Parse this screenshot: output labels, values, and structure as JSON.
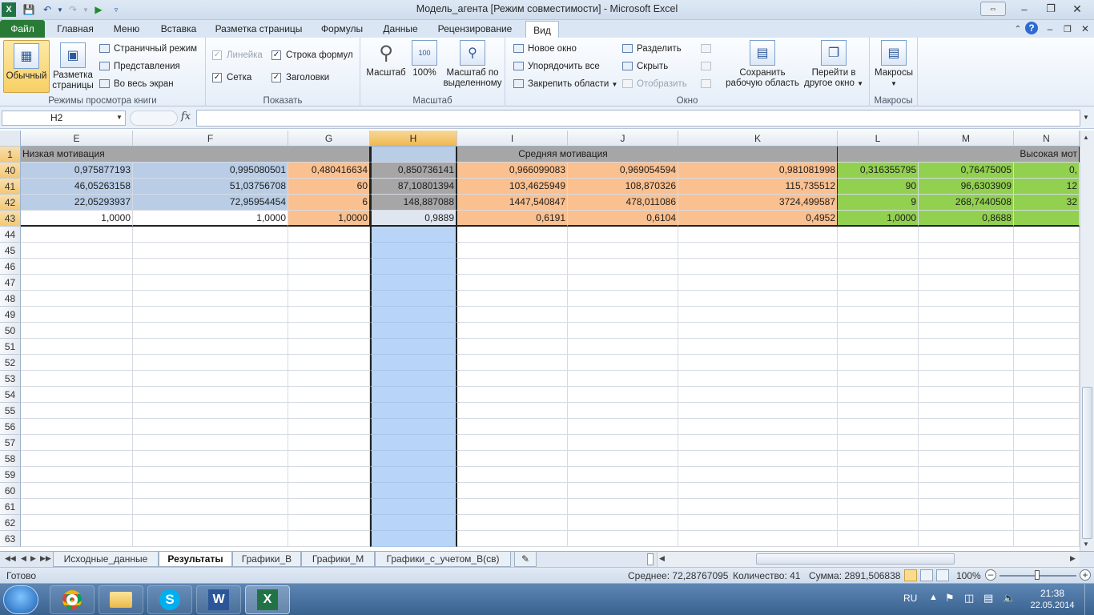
{
  "window": {
    "title": "Модель_агента  [Режим совместимости] - Microsoft Excel"
  },
  "ribbon_tabs": [
    "Файл",
    "Главная",
    "Меню",
    "Вставка",
    "Разметка страницы",
    "Формулы",
    "Данные",
    "Рецензирование",
    "Вид"
  ],
  "active_tab": "Вид",
  "ribbon": {
    "views": {
      "label": "Режимы просмотра книги",
      "normal": "Обычный",
      "page_layout_l1": "Разметка",
      "page_layout_l2": "страницы",
      "page_break": "Страничный режим",
      "custom_views": "Представления",
      "full_screen": "Во весь экран"
    },
    "show": {
      "label": "Показать",
      "ruler": "Линейка",
      "formula_bar": "Строка формул",
      "gridlines": "Сетка",
      "headings": "Заголовки"
    },
    "zoom": {
      "label": "Масштаб",
      "zoom": "Масштаб",
      "hundred": "100%",
      "to_sel_l1": "Масштаб по",
      "to_sel_l2": "выделенному"
    },
    "window": {
      "label": "Окно",
      "new_window": "Новое окно",
      "arrange_all": "Упорядочить все",
      "freeze": "Закрепить области",
      "split": "Разделить",
      "hide": "Скрыть",
      "unhide": "Отобразить",
      "save_ws_l1": "Сохранить",
      "save_ws_l2": "рабочую область",
      "switch_l1": "Перейти в",
      "switch_l2": "другое окно"
    },
    "macros": {
      "label": "Макросы",
      "button": "Макросы"
    }
  },
  "formula_bar": {
    "name_box": "H2",
    "fx": "fx",
    "value": ""
  },
  "columns": [
    "E",
    "F",
    "G",
    "H",
    "I",
    "J",
    "K",
    "L",
    "M",
    "N"
  ],
  "row_headers": [
    "1",
    "40",
    "41",
    "42",
    "43",
    "44",
    "45",
    "46",
    "47",
    "48",
    "49",
    "50",
    "51",
    "52",
    "53",
    "54",
    "55",
    "56",
    "57",
    "58",
    "59",
    "60",
    "61",
    "62",
    "63"
  ],
  "row1": {
    "low": "Низкая мотивация",
    "mid": "Средняя мотивация",
    "high": "Высокая мот"
  },
  "rows": [
    {
      "E": "0,975877193",
      "F": "0,995080501",
      "G": "0,480416634",
      "H": "0,850736141",
      "I": "0,966099083",
      "J": "0,969054594",
      "K": "0,981081998",
      "L": "0,316355795",
      "M": "0,76475005",
      "N": "0,"
    },
    {
      "E": "46,05263158",
      "F": "51,03756708",
      "G": "60",
      "H": "87,10801394",
      "I": "103,4625949",
      "J": "108,870326",
      "K": "115,735512",
      "L": "90",
      "M": "96,6303909",
      "N": "12"
    },
    {
      "E": "22,05293937",
      "F": "72,95954454",
      "G": "6",
      "H": "148,887088",
      "I": "1447,540847",
      "J": "478,011086",
      "K": "3724,499587",
      "L": "9",
      "M": "268,7440508",
      "N": "32"
    },
    {
      "E": "1,0000",
      "F": "1,0000",
      "G": "1,0000",
      "H": "0,9889",
      "I": "0,6191",
      "J": "0,6104",
      "K": "0,4952",
      "L": "1,0000",
      "M": "0,8688",
      "N": ""
    }
  ],
  "sheet_tabs": [
    "Исходные_данные",
    "Результаты",
    "Графики_В",
    "Графики_М",
    "Графики_с_учетом_В(св)"
  ],
  "active_sheet": "Результаты",
  "status": {
    "ready": "Готово",
    "average": "Среднее: 72,28767095",
    "count": "Количество: 41",
    "sum": "Сумма: 2891,506838",
    "zoom": "100%"
  },
  "taskbar": {
    "lang": "RU",
    "time": "21:38",
    "date": "22.05.2014"
  },
  "colors": {
    "blue": "#b9cde6",
    "orange": "#fac090",
    "gray": "#a6a6a6",
    "green": "#92d050",
    "selection": "#b8d5f7",
    "file_tab": "#2a7a37"
  }
}
